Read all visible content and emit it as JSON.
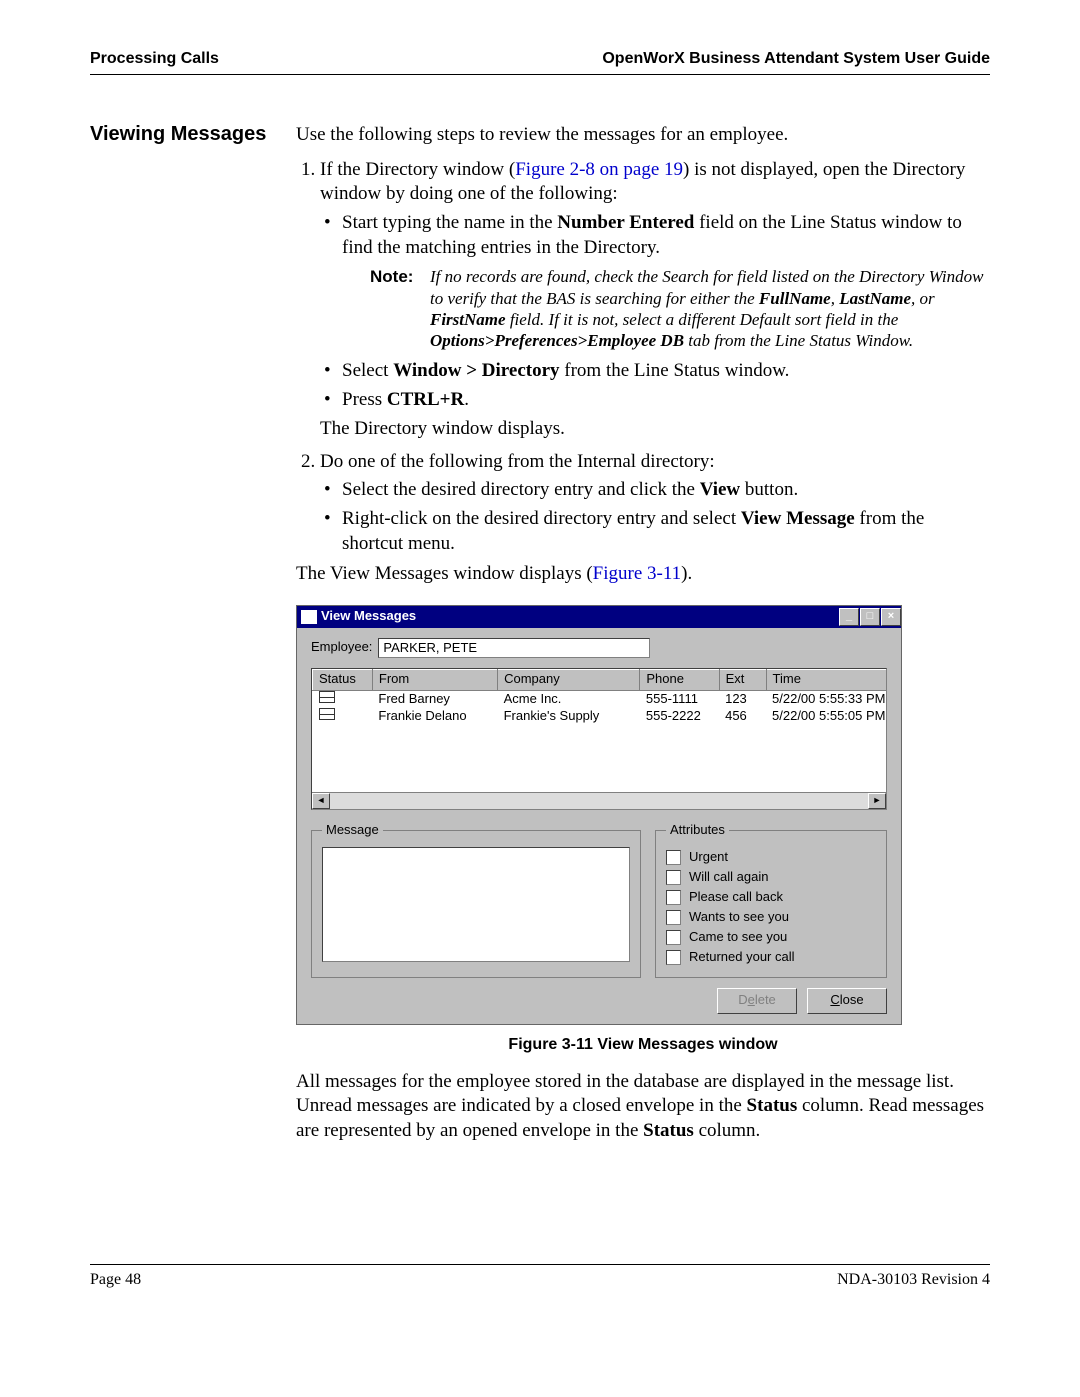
{
  "header": {
    "left": "Processing Calls",
    "right": "OpenWorX Business Attendant System User Guide"
  },
  "section_title": "Viewing Messages",
  "intro": "Use the following steps to review the messages for an employee.",
  "step1_a": "If the Directory window (",
  "step1_link": "Figure 2-8 on page 19",
  "step1_b": ") is not displayed, open the Directory window by doing one of the following:",
  "b1_a": "Start typing the name in the ",
  "b1_bold": "Number Entered",
  "b1_b": " field on the Line Status window to find the matching entries in the Directory.",
  "note_label": "Note:",
  "note_a": "If no records are found, check the Search for field listed on the Directory Window to verify that the BAS is searching for either the ",
  "note_full": "FullName",
  "note_b": ", ",
  "note_last": "LastName",
  "note_c": ", or ",
  "note_first": "FirstName",
  "note_d": " field. If it is not, select a different Default sort field in the ",
  "note_path": "Options>Preferences>Employee DB",
  "note_e": " tab from the Line Status Window.",
  "b2_a": "Select ",
  "b2_bold": "Window > Directory",
  "b2_b": " from the Line Status window.",
  "b3_a": "Press ",
  "b3_bold": "CTRL+R",
  "b3_b": ".",
  "after1": "The Directory window displays.",
  "step2": "Do one of the following from the Internal directory:",
  "b4_a": "Select the desired directory entry and click the ",
  "b4_bold": "View",
  "b4_b": " button.",
  "b5_a": "Right-click on the desired directory entry and select ",
  "b5_bold": "View Message",
  "b5_b": " from the shortcut menu.",
  "para_a": "The View Messages window displays (",
  "para_link": "Figure 3-11",
  "para_b": ").",
  "app": {
    "title": "View Messages",
    "min": "_",
    "max": "□",
    "close": "×",
    "employee_label": "Employee:",
    "employee_value": "PARKER, PETE",
    "cols": {
      "status": "Status",
      "from": "From",
      "company": "Company",
      "phone": "Phone",
      "ext": "Ext",
      "time": "Time"
    },
    "rows": [
      {
        "from": "Fred Barney",
        "company": "Acme Inc.",
        "phone": "555-1111",
        "ext": "123",
        "time": "5/22/00 5:55:33 PM"
      },
      {
        "from": "Frankie Delano",
        "company": "Frankie's Supply",
        "phone": "555-2222",
        "ext": "456",
        "time": "5/22/00 5:55:05 PM"
      }
    ],
    "left_arrow": "◄",
    "right_arrow": "►",
    "msg_legend": "Message",
    "attr_legend": "Attributes",
    "attrs": [
      "Urgent",
      "Will call again",
      "Please call back",
      "Wants to see you",
      "Came to see you",
      "Returned your call"
    ],
    "delete_pre": "D",
    "delete_u": "e",
    "delete_post": "lete",
    "close_u": "C",
    "close_post": "lose"
  },
  "fig_caption": "Figure 3-11   View Messages window",
  "body2_a": "All messages for the employee stored in the database are displayed in the message list. Unread messages are indicated by a closed envelope in the ",
  "body2_s1": "Status",
  "body2_b": " column. Read messages are represented by an opened envelope in the ",
  "body2_s2": "Status",
  "body2_c": " column.",
  "footer": {
    "left": "Page 48",
    "right": "NDA-30103  Revision 4"
  }
}
